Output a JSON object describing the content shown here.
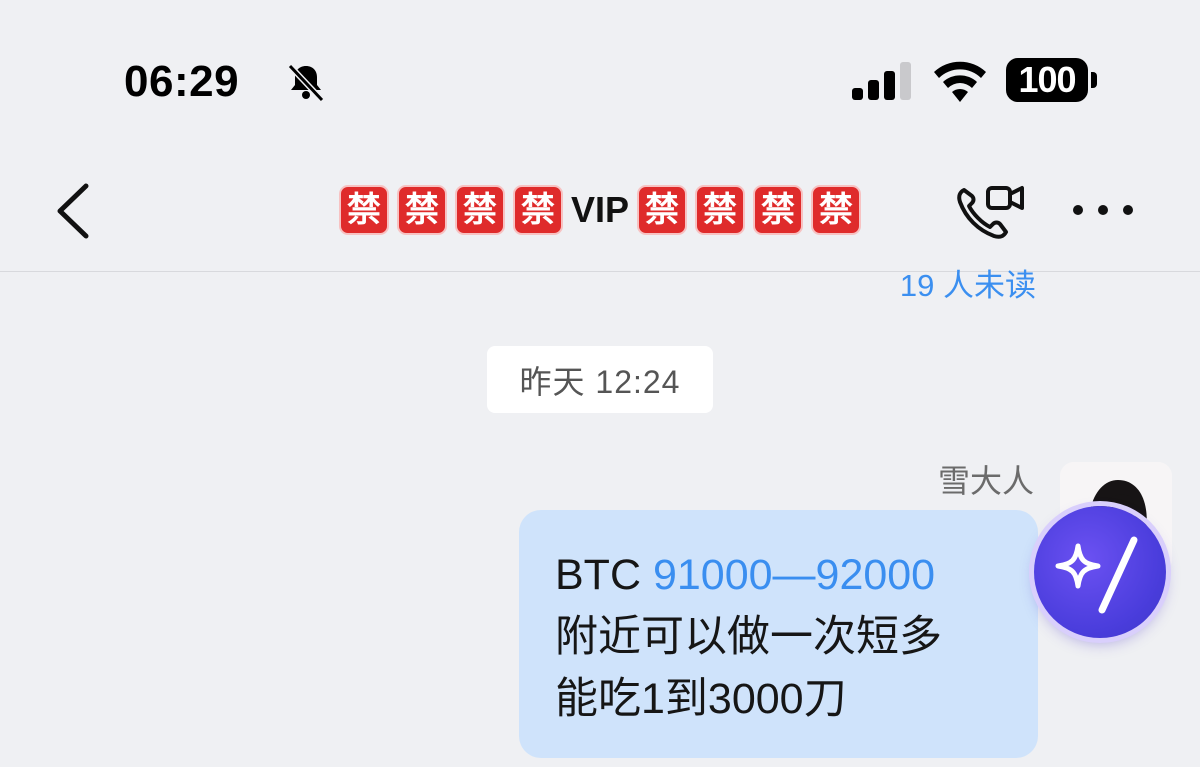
{
  "status_bar": {
    "time": "06:29",
    "battery": "100",
    "icons": [
      "bell-muted-icon",
      "signal-icon",
      "wifi-icon",
      "battery-icon"
    ]
  },
  "nav": {
    "back_icon": "chevron-left-icon",
    "title_prefix_icons": [
      "禁",
      "禁",
      "禁",
      "禁"
    ],
    "title_text": "VIP",
    "title_suffix_icons": [
      "禁",
      "禁",
      "禁",
      "禁"
    ],
    "call_icon": "phone-video-icon",
    "more_icon": "more-dots-icon"
  },
  "chat": {
    "unread_text": "19 人未读",
    "date_separator": "昨天 12:24",
    "message": {
      "sender": "雪大人",
      "prefix": "BTC ",
      "highlight": "91000—92000",
      "line2": "附近可以做一次短多",
      "line3": "能吃1到3000刀"
    }
  },
  "floating": {
    "icon": "ai-sparkle-wand-icon"
  },
  "colors": {
    "background": "#eff0f3",
    "bubble": "#cfe3fb",
    "link_blue": "#3a8ef0",
    "ban_red": "#df2b2b",
    "fab_purple": "#4a3ddc"
  }
}
